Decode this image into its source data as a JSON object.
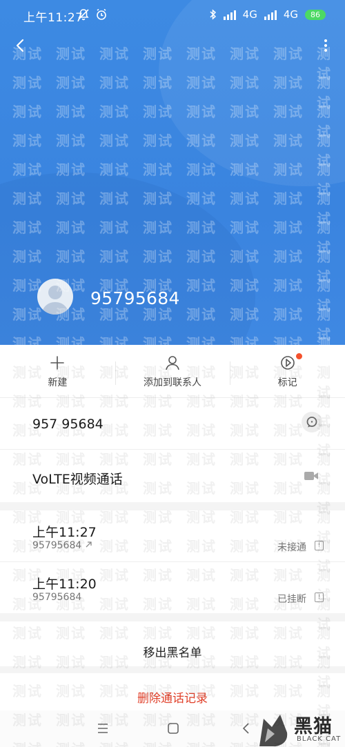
{
  "status_bar": {
    "time": "上午11:27",
    "network_1": "4G",
    "network_2": "4G",
    "battery": "86"
  },
  "contact": {
    "number_title": "95795684"
  },
  "actions": [
    {
      "label": "新建",
      "icon": "plus-icon"
    },
    {
      "label": "添加到联系人",
      "icon": "person-icon"
    },
    {
      "label": "标记",
      "icon": "tag-icon"
    }
  ],
  "number_row": {
    "formatted_number": "957 95684"
  },
  "volte_row": {
    "label": "VoLTE视频通话"
  },
  "call_log": [
    {
      "time": "上午11:27",
      "number": "95795684",
      "status": "未接通"
    },
    {
      "time": "上午11:20",
      "number": "95795684",
      "status": "已挂断"
    }
  ],
  "blacklist_label": "移出黑名单",
  "delete_label": "删除通话记录",
  "logo": {
    "text": "黑猫",
    "sub": "BLACK CAT"
  },
  "watermark_text": "测试",
  "colors": {
    "header_blue": "#3d8ae3",
    "delete_red": "#e0402a",
    "badge_orange": "#f4512c",
    "battery_green": "#4cd964"
  }
}
